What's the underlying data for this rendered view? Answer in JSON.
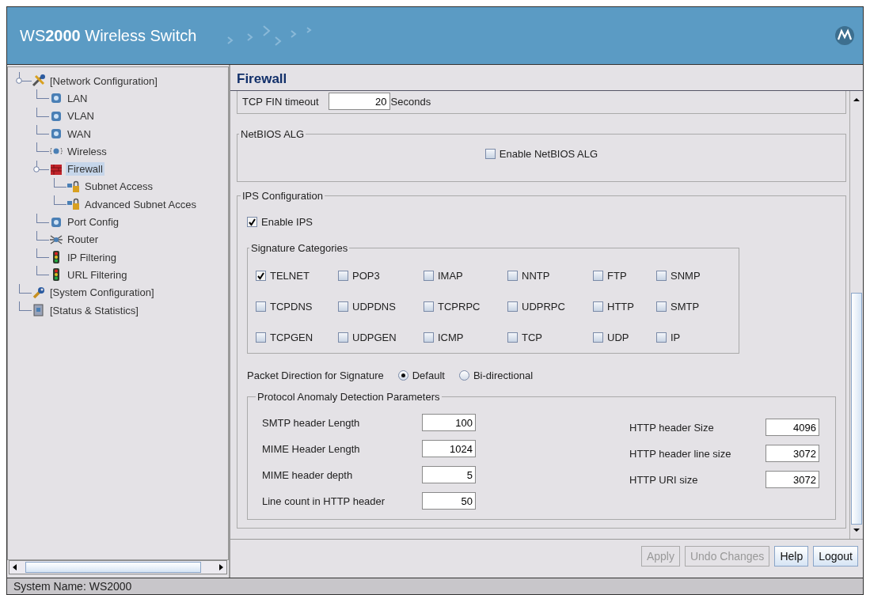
{
  "header": {
    "title": "WS**2000** Wireless Switch"
  },
  "tree": [
    {
      "label": "[Network Configuration]",
      "kind": "tools",
      "selected": false,
      "children": [
        {
          "label": "LAN",
          "kind": "device",
          "selected": false
        },
        {
          "label": "VLAN",
          "kind": "device",
          "selected": false
        },
        {
          "label": "WAN",
          "kind": "device",
          "selected": false
        },
        {
          "label": "Wireless",
          "kind": "wireless",
          "selected": false
        },
        {
          "label": "Firewall",
          "kind": "firewall",
          "selected": true,
          "children": [
            {
              "label": "Subnet Access",
              "kind": "lock",
              "selected": false
            },
            {
              "label": "Advanced Subnet Acces",
              "kind": "lock",
              "selected": false
            }
          ]
        },
        {
          "label": "Port Config",
          "kind": "device",
          "selected": false
        },
        {
          "label": "Router",
          "kind": "router",
          "selected": false
        },
        {
          "label": "IP Filtering",
          "kind": "traffic",
          "selected": false
        },
        {
          "label": "URL Filtering",
          "kind": "traffic",
          "selected": false
        }
      ]
    },
    {
      "label": "[System Configuration]",
      "kind": "wrench",
      "selected": false
    },
    {
      "label": "[Status & Statistics]",
      "kind": "book",
      "selected": false
    }
  ],
  "panel": {
    "title": "Firewall",
    "tcp_fin": {
      "label": "TCP FIN timeout",
      "value": "20",
      "unit": "Seconds"
    },
    "netbios": {
      "legend": "NetBIOS ALG",
      "checkbox": {
        "label": "Enable NetBIOS ALG",
        "checked": false
      }
    },
    "ips": {
      "legend": "IPS Configuration",
      "enable": {
        "label": "Enable IPS",
        "checked": true
      },
      "signatures": {
        "legend": "Signature Categories",
        "items": [
          {
            "label": "TELNET",
            "checked": true
          },
          {
            "label": "POP3",
            "checked": false
          },
          {
            "label": "IMAP",
            "checked": false
          },
          {
            "label": "NNTP",
            "checked": false
          },
          {
            "label": "FTP",
            "checked": false
          },
          {
            "label": "SNMP",
            "checked": false
          },
          {
            "label": "TCPDNS",
            "checked": false
          },
          {
            "label": "UDPDNS",
            "checked": false
          },
          {
            "label": "TCPRPC",
            "checked": false
          },
          {
            "label": "UDPRPC",
            "checked": false
          },
          {
            "label": "HTTP",
            "checked": false
          },
          {
            "label": "SMTP",
            "checked": false
          },
          {
            "label": "TCPGEN",
            "checked": false
          },
          {
            "label": "UDPGEN",
            "checked": false
          },
          {
            "label": "ICMP",
            "checked": false
          },
          {
            "label": "TCP",
            "checked": false
          },
          {
            "label": "UDP",
            "checked": false
          },
          {
            "label": "IP",
            "checked": false
          }
        ]
      },
      "direction": {
        "label": "Packet Direction for Signature",
        "options": [
          {
            "label": "Default",
            "selected": true
          },
          {
            "label": "Bi-directional",
            "selected": false
          }
        ]
      },
      "anomaly": {
        "legend": "Protocol Anomaly Detection Parameters",
        "left": [
          {
            "label": "SMTP header Length",
            "value": "100"
          },
          {
            "label": "MIME Header Length",
            "value": "1024"
          },
          {
            "label": "MIME header depth",
            "value": "5"
          },
          {
            "label": "Line count in HTTP header",
            "value": "50"
          }
        ],
        "right": [
          {
            "label": "HTTP header Size",
            "value": "4096"
          },
          {
            "label": "HTTP header line size",
            "value": "3072"
          },
          {
            "label": "HTTP URI size",
            "value": "3072"
          }
        ]
      }
    }
  },
  "buttons": [
    {
      "label": "Apply",
      "disabled": true
    },
    {
      "label": "Undo Changes",
      "disabled": true
    },
    {
      "label": "Help",
      "disabled": false
    },
    {
      "label": "Logout",
      "disabled": false
    }
  ],
  "status_bar": "System Name: WS2000"
}
